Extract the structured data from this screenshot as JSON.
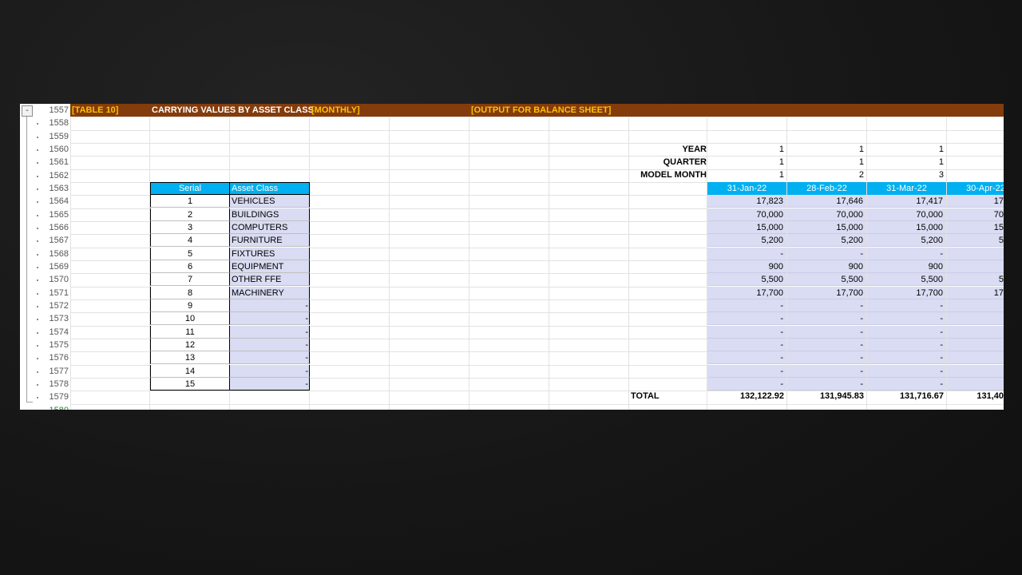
{
  "banner": {
    "table_id": "[TABLE 10]",
    "title": "CARRYING VALUES BY ASSET CLASS",
    "period": "[MONTHLY]",
    "note": "[OUTPUT FOR BALANCE SHEET]",
    "background_color": "#843C0C",
    "accent_color": "#FFC000"
  },
  "outline": {
    "collapse_label": "-"
  },
  "row_numbers": [
    "1557",
    "1558",
    "1559",
    "1560",
    "1561",
    "1562",
    "1563",
    "1564",
    "1565",
    "1566",
    "1567",
    "1568",
    "1569",
    "1570",
    "1571",
    "1572",
    "1573",
    "1574",
    "1575",
    "1576",
    "1577",
    "1578",
    "1579",
    "1580"
  ],
  "labels": {
    "year": "YEAR",
    "quarter": "QUARTER",
    "model_month": "MODEL MONTH",
    "total": "TOTAL"
  },
  "year_values": [
    "1",
    "1",
    "1"
  ],
  "quarter_values": [
    "1",
    "1",
    "1"
  ],
  "model_month_values": [
    "1",
    "2",
    "3"
  ],
  "asset_table": {
    "header_color": "#00B0F0",
    "fill_color": "#D9DCF2",
    "col_serial": "Serial",
    "col_class": "Asset Class",
    "rows": [
      {
        "serial": "1",
        "name": "VEHICLES"
      },
      {
        "serial": "2",
        "name": "BUILDINGS"
      },
      {
        "serial": "3",
        "name": "COMPUTERS"
      },
      {
        "serial": "4",
        "name": "FURNITURE"
      },
      {
        "serial": "5",
        "name": "FIXTURES"
      },
      {
        "serial": "6",
        "name": "EQUIPMENT"
      },
      {
        "serial": "7",
        "name": "OTHER FFE"
      },
      {
        "serial": "8",
        "name": "MACHINERY"
      },
      {
        "serial": "9",
        "name": "-"
      },
      {
        "serial": "10",
        "name": "-"
      },
      {
        "serial": "11",
        "name": "-"
      },
      {
        "serial": "12",
        "name": "-"
      },
      {
        "serial": "13",
        "name": "-"
      },
      {
        "serial": "14",
        "name": "-"
      },
      {
        "serial": "15",
        "name": "-"
      }
    ]
  },
  "dates": [
    "31-Jan-22",
    "28-Feb-22",
    "31-Mar-22",
    "30-Apr-22"
  ],
  "values": {
    "jan": [
      "17,823",
      "70,000",
      "15,000",
      "5,200",
      "-",
      "900",
      "5,500",
      "17,700",
      "-",
      "-",
      "-",
      "-",
      "-",
      "-",
      "-"
    ],
    "feb": [
      "17,646",
      "70,000",
      "15,000",
      "5,200",
      "-",
      "900",
      "5,500",
      "17,700",
      "-",
      "-",
      "-",
      "-",
      "-",
      "-",
      "-"
    ],
    "mar": [
      "17,417",
      "70,000",
      "15,000",
      "5,200",
      "-",
      "900",
      "5,500",
      "17,700",
      "-",
      "-",
      "-",
      "-",
      "-",
      "-",
      "-"
    ],
    "apr": [
      "17",
      "70",
      "15",
      "5",
      "",
      "",
      "5",
      "17",
      "",
      "",
      "",
      "",
      "",
      "",
      ""
    ]
  },
  "totals": [
    "132,122.92",
    "131,945.83",
    "131,716.67",
    "131,40"
  ]
}
